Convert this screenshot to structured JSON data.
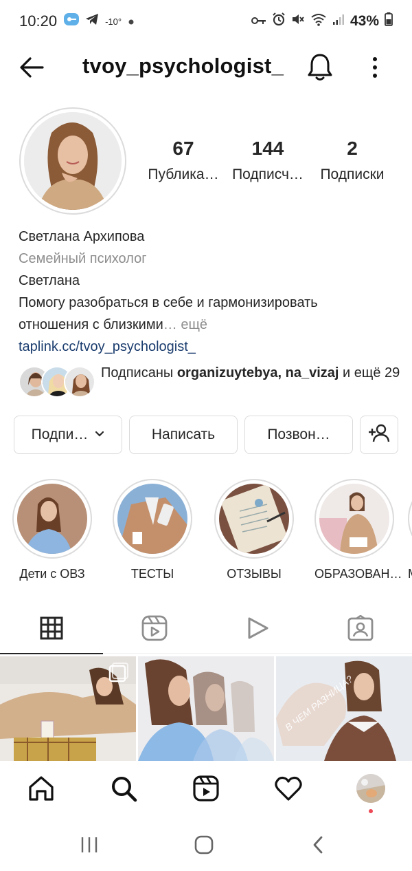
{
  "status_bar": {
    "time": "10:20",
    "temperature": "-10°",
    "battery": "43%",
    "icons": [
      "vpn-key-icon",
      "telegram-icon",
      "dot-icon",
      "key-icon",
      "alarm-icon",
      "mute-icon",
      "wifi-icon",
      "signal-icon",
      "battery-icon"
    ]
  },
  "header": {
    "username": "tvoy_psychologist_",
    "icons": [
      "back-arrow-icon",
      "bell-icon",
      "more-vertical-icon"
    ]
  },
  "stats": {
    "posts": {
      "value": "67",
      "label": "Публика…"
    },
    "followers": {
      "value": "144",
      "label": "Подписч…"
    },
    "following": {
      "value": "2",
      "label": "Подписки"
    }
  },
  "bio": {
    "name": "Светлана Архипова",
    "category": "Семейный психолог",
    "line1": "Светлана",
    "line2": "Помогу разобраться в себе и гармонизировать",
    "line3": "отношения с близкими",
    "more": "… ещё",
    "link": "taplink.cc/tvoy_psychologist_"
  },
  "followed_by": {
    "prefix": "Подписаны ",
    "names": "organizuytebya, na_vizaj",
    "suffix": " и ещё 29"
  },
  "actions": {
    "follow": "Подпи…",
    "message": "Написать",
    "call": "Позвон…"
  },
  "highlights": [
    {
      "label": "Дети с ОВЗ"
    },
    {
      "label": "ТЕСТЫ"
    },
    {
      "label": "ОТЗЫВЫ"
    },
    {
      "label": "ОБРАЗОВАН…"
    },
    {
      "label": "М"
    }
  ],
  "tabs": [
    "grid-icon",
    "reels-icon",
    "video-play-icon",
    "tagged-icon"
  ],
  "grid": {
    "post3_overlay_text": "В ЧЕМ РАЗНИЦА?"
  },
  "bottom_nav": [
    "home-icon",
    "search-icon",
    "reels-icon",
    "heart-icon",
    "profile-avatar"
  ],
  "colors": {
    "link": "#1a3c6e",
    "secondary_text": "#8e8e8e",
    "border": "#dbdbdb",
    "notification_dot": "#ed4956"
  }
}
